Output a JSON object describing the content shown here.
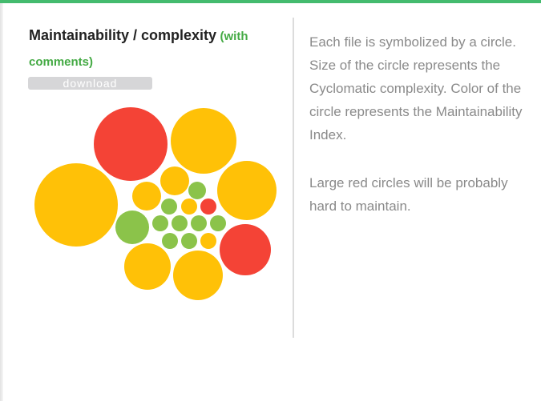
{
  "panel": {
    "title": "Maintainability / complexity",
    "subtitle": "(with comments)",
    "download_label": "download"
  },
  "description": {
    "paragraph1": "Each file is symbolized by a circle. Size of the circle represents the Cyclomatic complexity. Color of the circle represents the Maintainability Index.",
    "paragraph2": "Large red circles will be probably hard to maintain."
  },
  "colors": {
    "accent_bar": "#44bb6e",
    "good": "#8bc34a",
    "medium": "#ffc107",
    "bad": "#f44336"
  },
  "chart_data": {
    "type": "bubble",
    "encoding": "circle size = cyclomatic complexity, circle color = maintainability index",
    "files": [
      {
        "maintainability": "bad",
        "complexity": 46
      },
      {
        "maintainability": "medium",
        "complexity": 41
      },
      {
        "maintainability": "medium",
        "complexity": 52
      },
      {
        "maintainability": "medium",
        "complexity": 37
      },
      {
        "maintainability": "medium",
        "complexity": 18
      },
      {
        "maintainability": "medium",
        "complexity": 18
      },
      {
        "maintainability": "good",
        "complexity": 11
      },
      {
        "maintainability": "good",
        "complexity": 21
      },
      {
        "maintainability": "good",
        "complexity": 10
      },
      {
        "maintainability": "medium",
        "complexity": 10
      },
      {
        "maintainability": "bad",
        "complexity": 10
      },
      {
        "maintainability": "good",
        "complexity": 10
      },
      {
        "maintainability": "good",
        "complexity": 10
      },
      {
        "maintainability": "good",
        "complexity": 10
      },
      {
        "maintainability": "good",
        "complexity": 10
      },
      {
        "maintainability": "good",
        "complexity": 10
      },
      {
        "maintainability": "good",
        "complexity": 10
      },
      {
        "maintainability": "medium",
        "complexity": 10
      },
      {
        "maintainability": "medium",
        "complexity": 29
      },
      {
        "maintainability": "medium",
        "complexity": 31
      },
      {
        "maintainability": "bad",
        "complexity": 32
      }
    ]
  }
}
